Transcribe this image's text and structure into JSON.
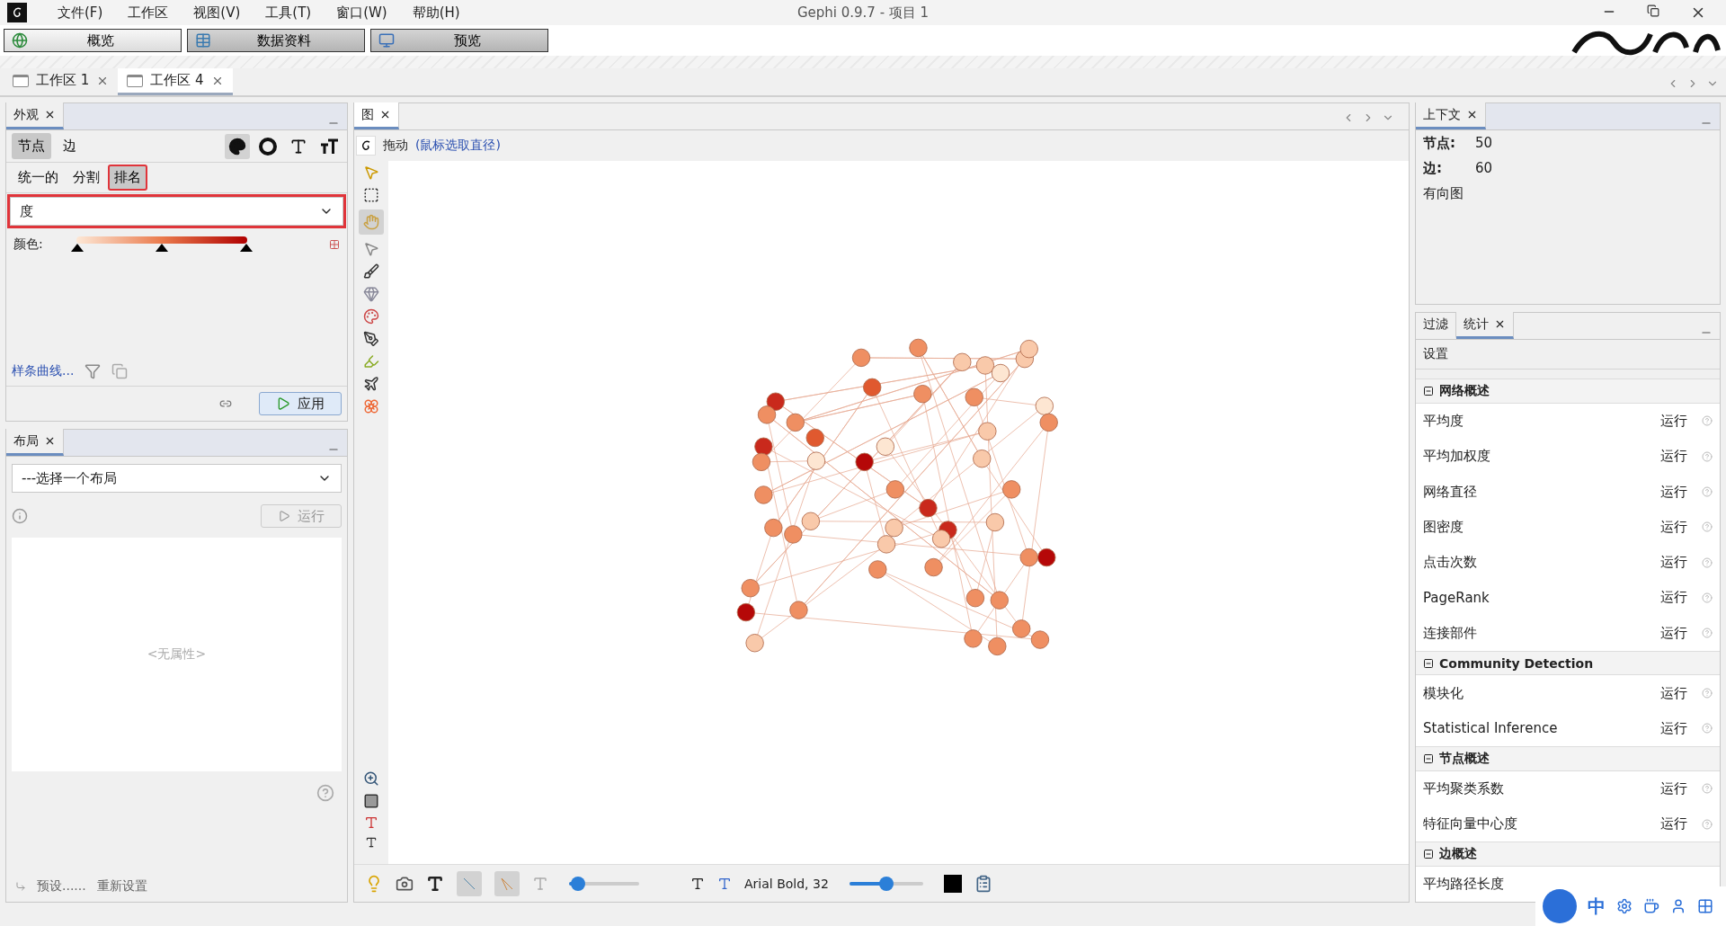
{
  "window": {
    "title": "Gephi 0.9.7 - 项目 1"
  },
  "menu": [
    "文件(F)",
    "工作区",
    "视图(V)",
    "工具(T)",
    "窗口(W)",
    "帮助(H)"
  ],
  "perspectives": [
    {
      "label": "概览",
      "kind": "overview",
      "selected": true
    },
    {
      "label": "数据资料",
      "kind": "data",
      "selected": false
    },
    {
      "label": "预览",
      "kind": "preview",
      "selected": false
    }
  ],
  "workspace_tabs": [
    {
      "label": "工作区 1",
      "selected": false
    },
    {
      "label": "工作区 4",
      "selected": true
    }
  ],
  "appearance": {
    "title": "外观",
    "element_tabs": [
      {
        "label": "节点",
        "selected": true
      },
      {
        "label": "边",
        "selected": false
      }
    ],
    "mode_tabs": [
      {
        "label": "统一的",
        "selected": false,
        "highlighted": false
      },
      {
        "label": "分割",
        "selected": false,
        "highlighted": false
      },
      {
        "label": "排名",
        "selected": true,
        "highlighted": true
      }
    ],
    "attribute": {
      "value": "度",
      "highlighted": true
    },
    "color_label": "颜色:",
    "spline_link": "样条曲线...",
    "apply_button": "应用"
  },
  "layout": {
    "title": "布局",
    "dropdown": {
      "value": "---选择一个布局"
    },
    "run_button": {
      "label": "运行",
      "disabled": true
    },
    "properties_placeholder": "<无属性>",
    "presets_link": "预设......",
    "reset_link": "重新设置"
  },
  "graph": {
    "title": "图",
    "tool_name": "拖动",
    "tool_hint": "(鼠标选取直径)",
    "font_label": "Arial Bold, 32",
    "edge_scale_slider": {
      "level": 0.13
    },
    "label_size_slider": {
      "level": 0.5
    }
  },
  "context": {
    "title": "上下文",
    "stats": [
      {
        "label": "节点:",
        "value": "50"
      },
      {
        "label": "边:",
        "value": "60"
      }
    ],
    "graph_type": "有向图"
  },
  "side_tabs": [
    {
      "label": "过滤",
      "selected": false
    },
    {
      "label": "统计",
      "selected": true
    }
  ],
  "statistics": {
    "settings_label": "设置",
    "groups": [
      {
        "title": "网络概述",
        "expanded": true,
        "items": [
          {
            "name": "平均度",
            "run": "运行"
          },
          {
            "name": "平均加权度",
            "run": "运行"
          },
          {
            "name": "网络直径",
            "run": "运行"
          },
          {
            "name": "图密度",
            "run": "运行"
          },
          {
            "name": "点击次数",
            "run": "运行"
          },
          {
            "name": "PageRank",
            "run": "运行"
          },
          {
            "name": "连接部件",
            "run": "运行"
          }
        ]
      },
      {
        "title": "Community Detection",
        "expanded": true,
        "items": [
          {
            "name": "模块化",
            "run": "运行"
          },
          {
            "name": "Statistical Inference",
            "run": "运行"
          }
        ]
      },
      {
        "title": "节点概述",
        "expanded": true,
        "items": [
          {
            "name": "平均聚类系数",
            "run": "运行"
          },
          {
            "name": "特征向量中心度",
            "run": "运行"
          }
        ]
      },
      {
        "title": "边概述",
        "expanded": true,
        "items": [
          {
            "name": "平均路径长度"
          }
        ]
      }
    ]
  },
  "ime_bar": {
    "mode": "中"
  }
}
